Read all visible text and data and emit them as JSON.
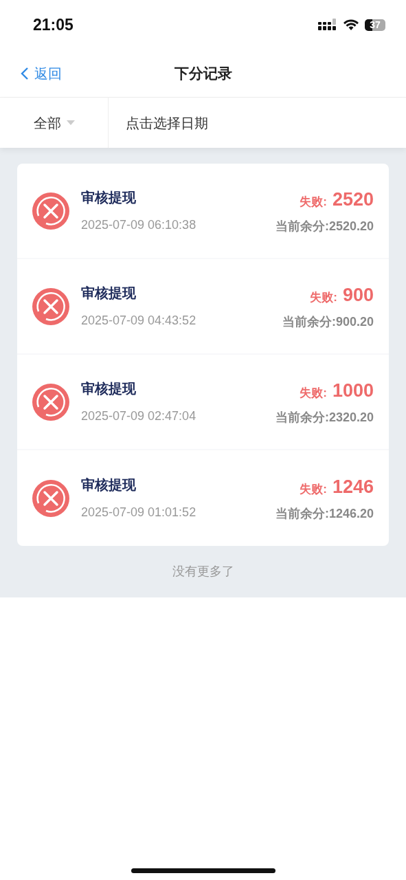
{
  "status_bar": {
    "time": "21:05",
    "battery": "37"
  },
  "nav": {
    "back": "返回",
    "title": "下分记录"
  },
  "filter": {
    "type": "全部",
    "date": "点击选择日期"
  },
  "records": [
    {
      "title": "审核提现",
      "time": "2025-07-09 06:10:38",
      "kind": "failed",
      "status_label": "失败:",
      "amount": "2520",
      "balance": "当前余分:2520.20"
    },
    {
      "title": "审核提现",
      "time": "2025-07-09 04:43:52",
      "kind": "failed",
      "status_label": "失败:",
      "amount": "900",
      "balance": "当前余分:900.20"
    },
    {
      "title": "审核提现",
      "time": "2025-07-09 02:47:04",
      "kind": "failed",
      "status_label": "失败:",
      "amount": "1000",
      "balance": "当前余分:2320.20"
    },
    {
      "title": "审核提现",
      "time": "2025-07-09 01:01:52",
      "kind": "failed",
      "status_label": "失败:",
      "amount": "1246",
      "balance": "当前余分:1246.20"
    }
  ],
  "footer": "没有更多了"
}
